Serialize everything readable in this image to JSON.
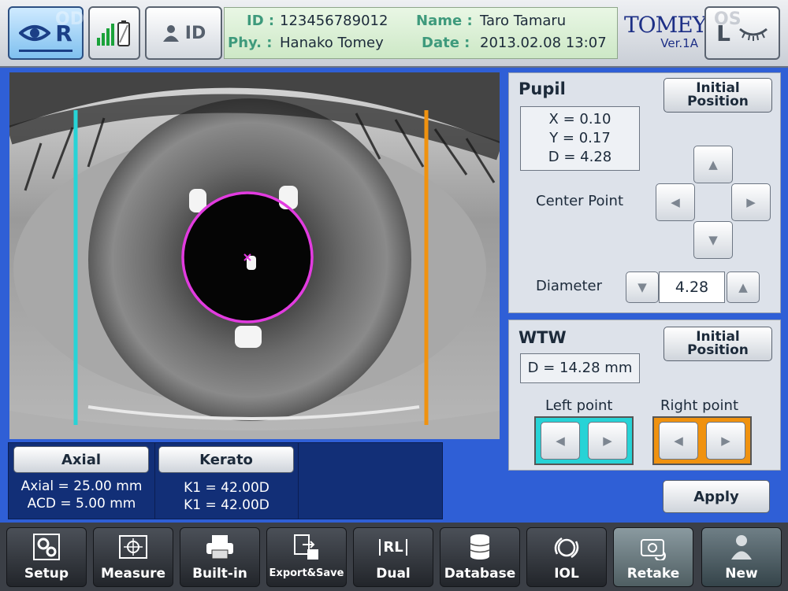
{
  "header": {
    "eye_right": {
      "letter": "R",
      "ghost": "OD"
    },
    "id_button_label": "ID",
    "patient": {
      "id_label": "ID :",
      "id_value": "123456789012",
      "name_label": "Name :",
      "name_value": "Taro Tamaru",
      "phy_label": "Phy. :",
      "phy_value": "Hanako Tomey",
      "date_label": "Date :",
      "date_value": "2013.02.08  13:07"
    },
    "brand": "TOMEY",
    "version": "Ver.1A",
    "eye_left": {
      "letter": "L",
      "ghost": "OS"
    }
  },
  "measurements": {
    "axial": {
      "button": "Axial",
      "line1": "Axial = 25.00 mm",
      "line2": "ACD = 5.00 mm"
    },
    "kerato": {
      "button": "Kerato",
      "line1": "K1 = 42.00D",
      "line2": "K1 = 42.00D"
    }
  },
  "pupil": {
    "title": "Pupil",
    "initial_position": "Initial Position",
    "x": "X = 0.10",
    "y": "Y = 0.17",
    "d": "D = 4.28",
    "center_point_label": "Center Point",
    "diameter_label": "Diameter",
    "diameter_value": "4.28"
  },
  "wtw": {
    "title": "WTW",
    "initial_position": "Initial Position",
    "d": "D = 14.28 mm",
    "left_point_label": "Left point",
    "right_point_label": "Right point"
  },
  "apply_label": "Apply",
  "toolbar": {
    "items": [
      {
        "label": "Setup",
        "icon": "gears-icon"
      },
      {
        "label": "Measure",
        "icon": "target-icon"
      },
      {
        "label": "Built-in",
        "icon": "printer-icon"
      },
      {
        "label": "Export&Save",
        "icon": "export-save-icon"
      },
      {
        "label": "Dual",
        "icon": "dual-rl-icon",
        "icon_text": "RL"
      },
      {
        "label": "Database",
        "icon": "database-icon"
      },
      {
        "label": "IOL",
        "icon": "iol-lens-icon"
      },
      {
        "label": "Retake",
        "icon": "camera-retake-icon"
      },
      {
        "label": "New",
        "icon": "person-icon"
      }
    ]
  },
  "colors": {
    "background_blue": "#2f5fd6",
    "pupil_circle": "#e23be0",
    "wtw_left_line": "#27d3d6",
    "wtw_right_line": "#f0920f",
    "left_point_box": "#27d3d6",
    "right_point_box": "#f0920f",
    "patient_label_green": "#3e9a7c",
    "brand_blue": "#1d2f86"
  }
}
